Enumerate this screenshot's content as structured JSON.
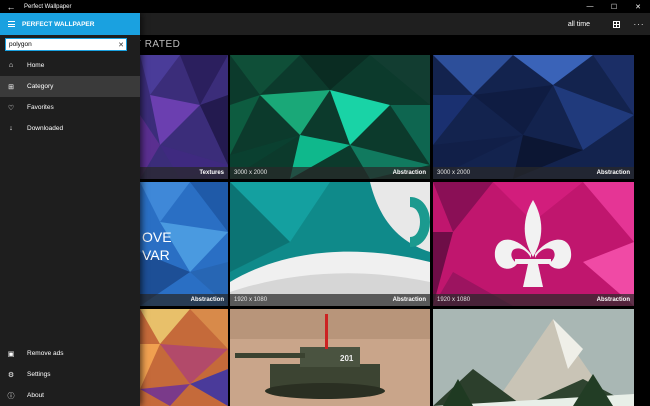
{
  "window": {
    "title": "Perfect Wallpaper",
    "back_glyph": "←",
    "min_glyph": "—",
    "max_glyph": "☐",
    "close_glyph": "✕"
  },
  "toolbar": {
    "time_filter": "all time",
    "more_glyph": "···"
  },
  "page": {
    "heading": "T RATED"
  },
  "pane": {
    "title": "PERFECT WALLPAPER",
    "search_value": "polygon",
    "clear_glyph": "✕",
    "nav": [
      {
        "label": "Home",
        "icon": "home-icon",
        "glyph": "⌂"
      },
      {
        "label": "Category",
        "icon": "category-grid-icon",
        "glyph": "⊞"
      },
      {
        "label": "Favorites",
        "icon": "heart-icon",
        "glyph": "♡"
      },
      {
        "label": "Downloaded",
        "icon": "download-icon",
        "glyph": "↓"
      }
    ],
    "bottom": [
      {
        "label": "Remove ads",
        "icon": "shopping-bag-icon",
        "glyph": "▣"
      },
      {
        "label": "Settings",
        "icon": "gear-icon",
        "glyph": "⚙"
      },
      {
        "label": "About",
        "icon": "info-icon",
        "glyph": "ⓘ"
      }
    ]
  },
  "tiles": [
    {
      "resolution": "",
      "category": "Textures"
    },
    {
      "resolution": "3000 x 2000",
      "category": "Abstraction"
    },
    {
      "resolution": "3000 x 2000",
      "category": "Abstraction"
    },
    {
      "resolution": "",
      "category": "Abstraction",
      "text_art": "OVE\nVAR"
    },
    {
      "resolution": "1920 x 1080",
      "category": "Abstraction"
    },
    {
      "resolution": "1920 x 1080",
      "category": "Abstraction"
    },
    {
      "resolution": "",
      "category": ""
    },
    {
      "resolution": "",
      "category": "",
      "tank_number": "201"
    },
    {
      "resolution": "",
      "category": ""
    }
  ],
  "colors": {
    "accent": "#1aa1e0",
    "pane_bg": "#1e1e1e",
    "active_item": "#3a3a3a"
  }
}
